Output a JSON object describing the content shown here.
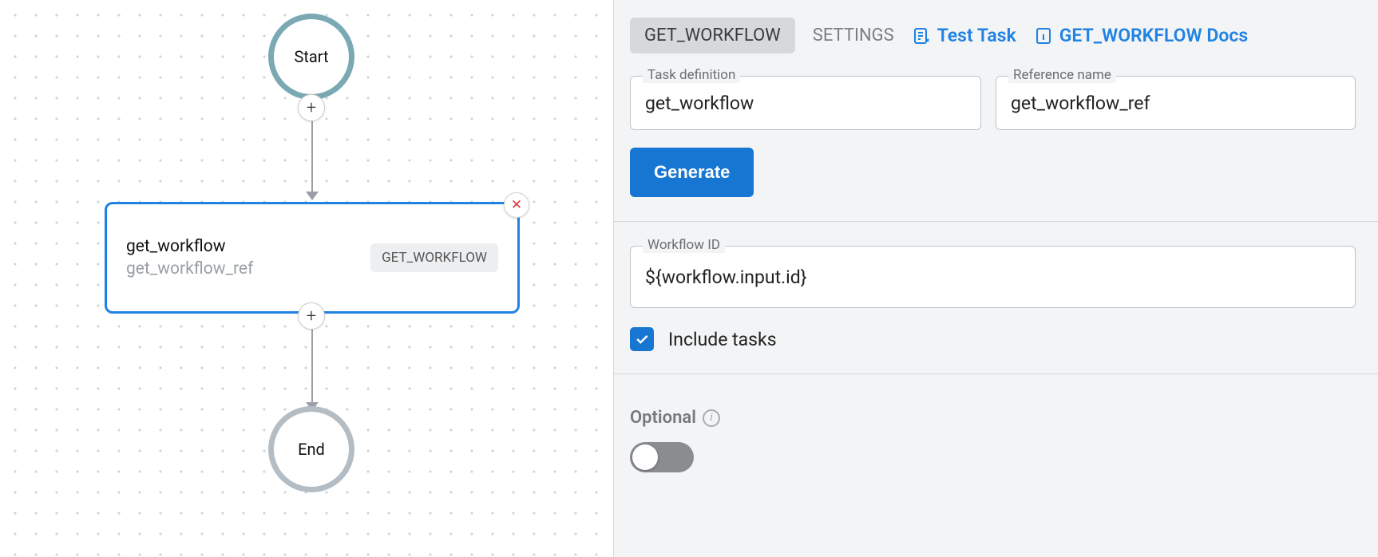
{
  "canvas": {
    "start_label": "Start",
    "end_label": "End",
    "task": {
      "title": "get_workflow",
      "ref": "get_workflow_ref",
      "badge": "GET_WORKFLOW"
    }
  },
  "panel": {
    "tabs": {
      "active": "GET_WORKFLOW",
      "settings": "SETTINGS",
      "test_task": "Test Task",
      "docs": "GET_WORKFLOW Docs"
    },
    "task_definition": {
      "label": "Task definition",
      "value": "get_workflow"
    },
    "reference_name": {
      "label": "Reference name",
      "value": "get_workflow_ref"
    },
    "generate": "Generate",
    "workflow_id": {
      "label": "Workflow ID",
      "value": "${workflow.input.id}"
    },
    "include_tasks": {
      "label": "Include tasks",
      "checked": true
    },
    "optional": {
      "label": "Optional",
      "value": false
    }
  }
}
